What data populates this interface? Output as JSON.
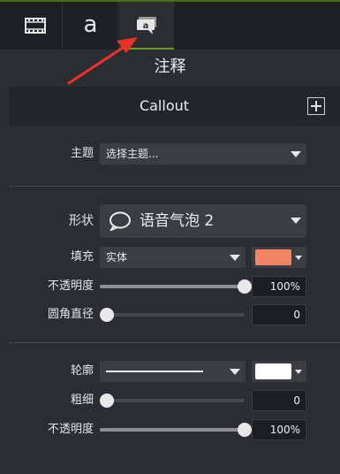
{
  "tabs": [
    {
      "name": "media",
      "icon": "film-strip-icon"
    },
    {
      "name": "text",
      "letter": "a"
    },
    {
      "name": "annotations",
      "icon": "callout-bubble-icon",
      "active": true
    }
  ],
  "panel": {
    "title": "注释",
    "section_title": "Callout"
  },
  "theme": {
    "label": "主题",
    "value": "选择主题..."
  },
  "shape": {
    "label": "形状",
    "value": "语音气泡 2"
  },
  "fill": {
    "label": "填充",
    "value": "实体",
    "color": "#f08566"
  },
  "fill_opacity": {
    "label": "不透明度",
    "value": "100%",
    "level": 1.0
  },
  "corner_radius": {
    "label": "圆角直径",
    "value": "0",
    "level": 0.0
  },
  "outline": {
    "label": "轮廓",
    "color": "#ffffff"
  },
  "thickness": {
    "label": "粗细",
    "value": "0",
    "level": 0.0
  },
  "outline_opacity": {
    "label": "不透明度",
    "value": "100%",
    "level": 1.0
  },
  "colors": {
    "accent": "#6f9a2a",
    "arrow": "#e8332a"
  }
}
